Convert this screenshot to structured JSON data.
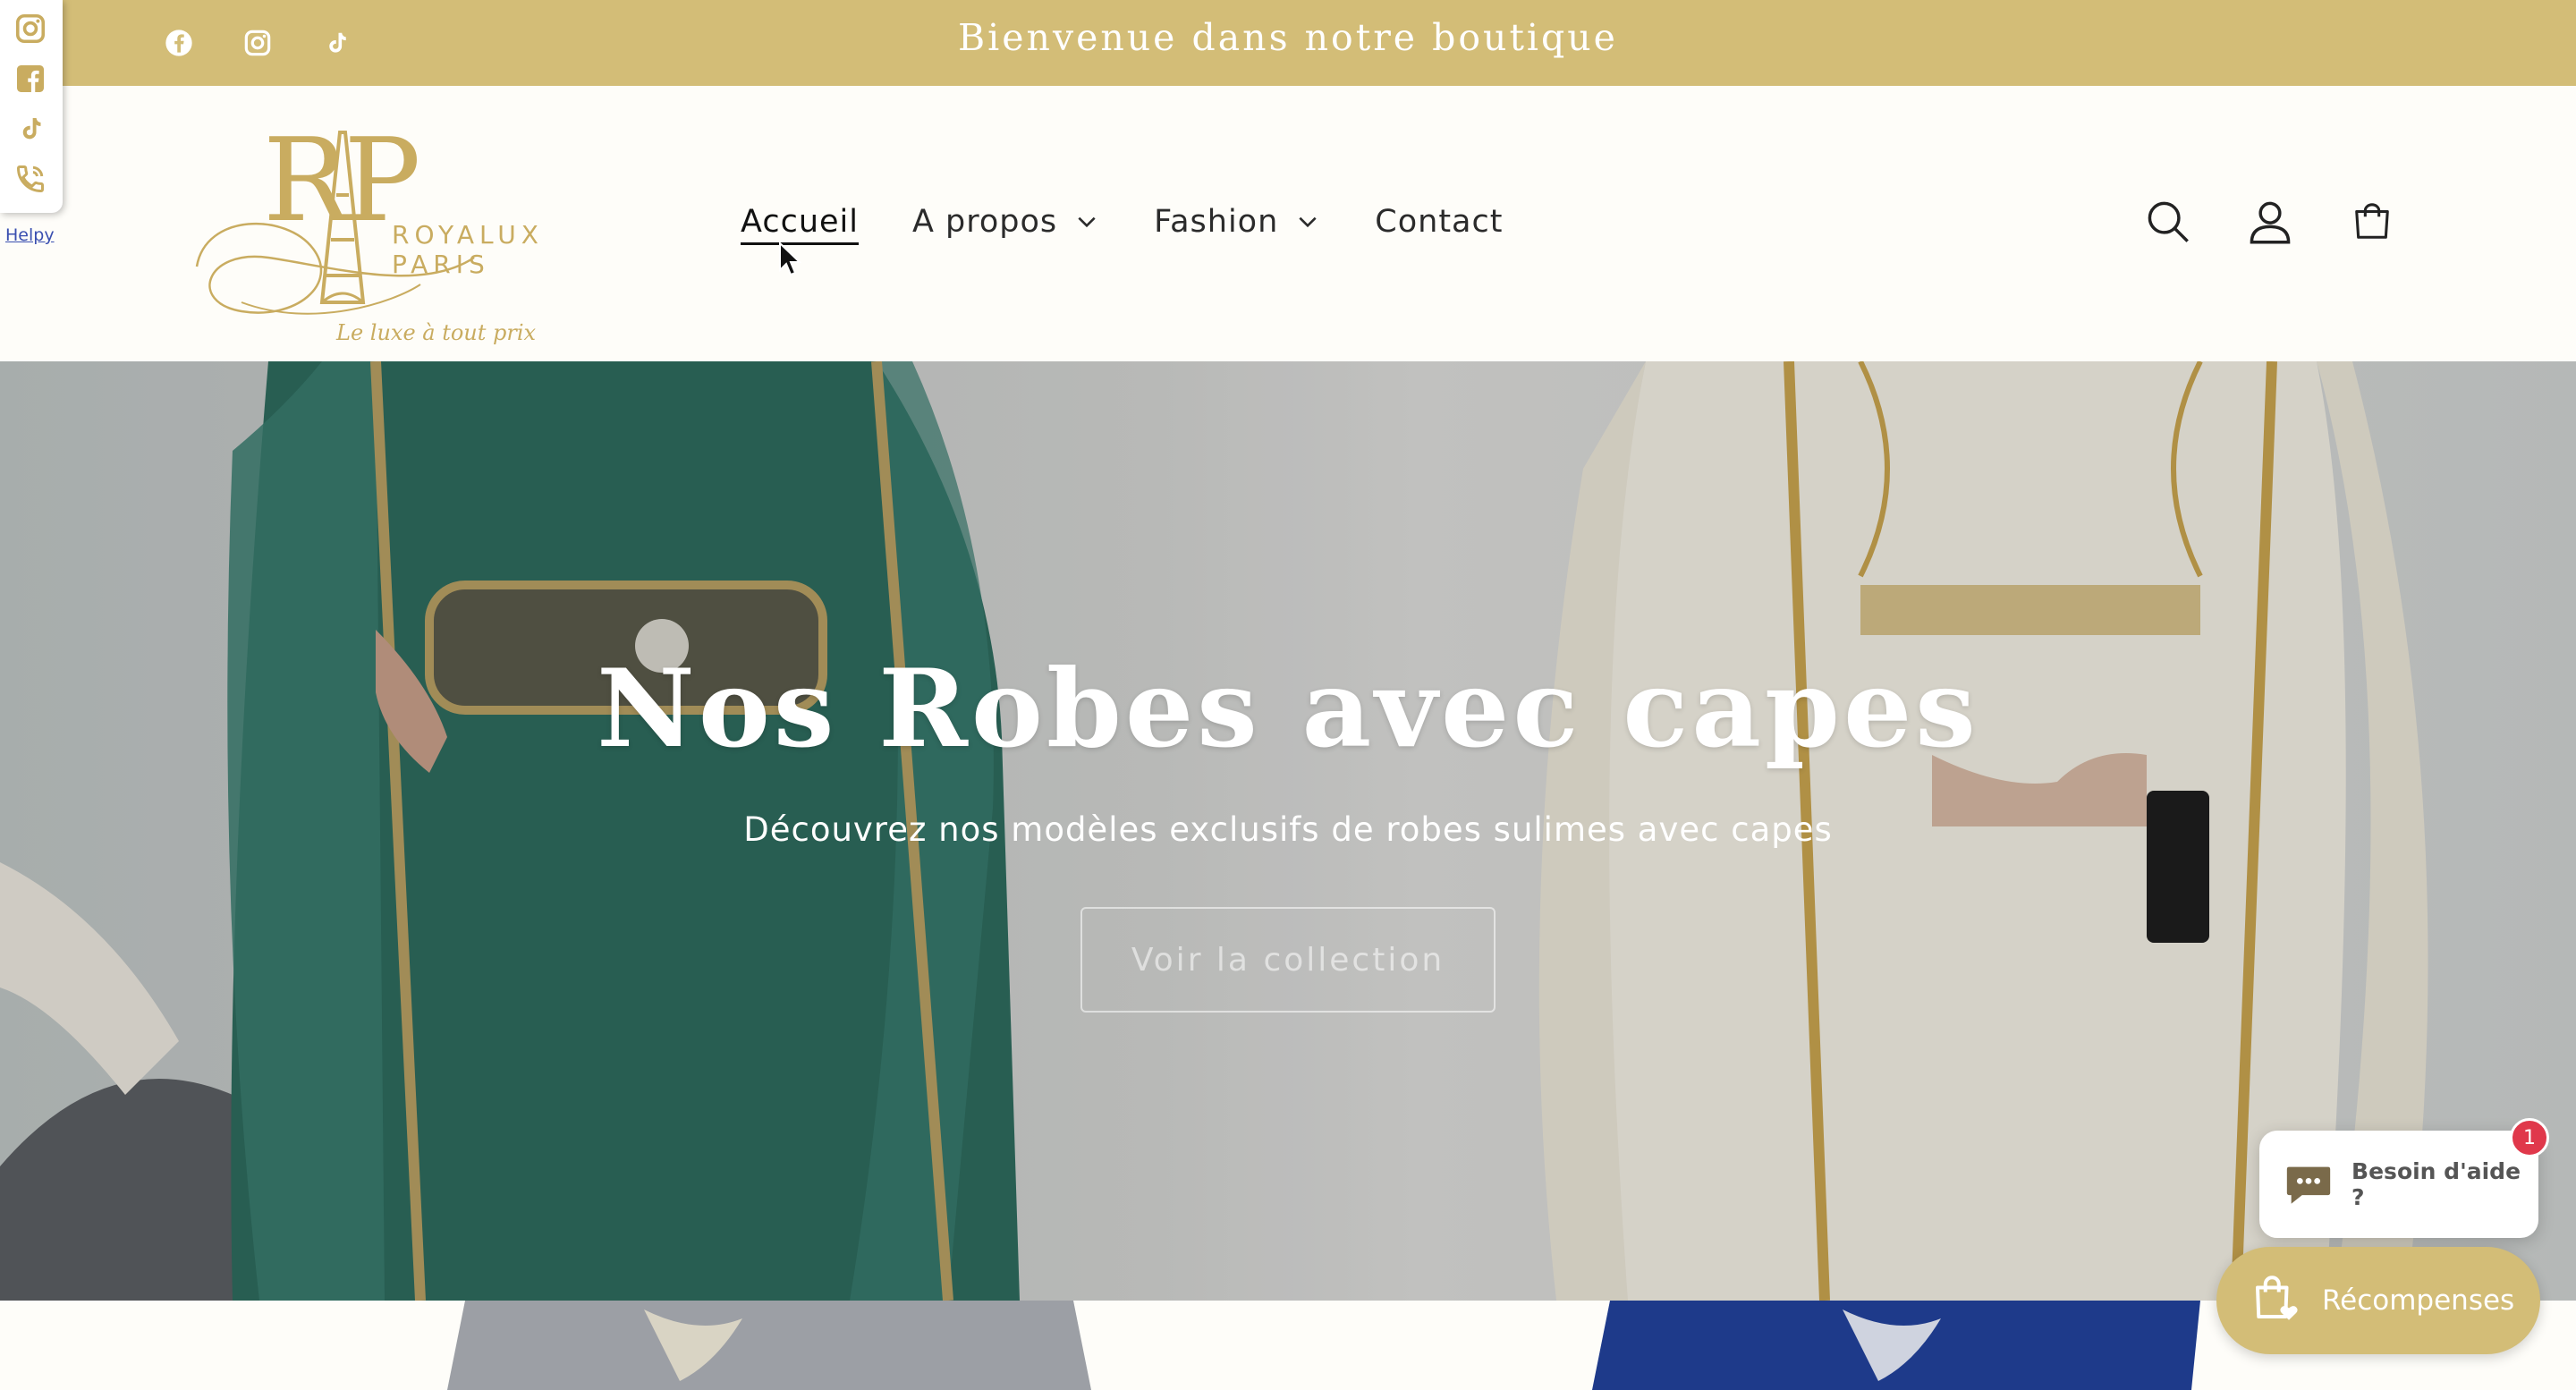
{
  "announcement": {
    "message": "Bienvenue dans notre boutique",
    "socials": [
      "facebook-icon",
      "instagram-icon",
      "tiktok-icon"
    ]
  },
  "helpy": {
    "icons": [
      "instagram-icon",
      "facebook-icon",
      "tiktok-icon",
      "phone-icon"
    ],
    "label": "Helpy"
  },
  "logo": {
    "monogram": "RP",
    "brand": "ROYALUX PARIS",
    "tagline": "Le luxe à tout prix"
  },
  "nav": {
    "items": [
      {
        "label": "Accueil",
        "active": true,
        "dropdown": false
      },
      {
        "label": "A propos",
        "active": false,
        "dropdown": true
      },
      {
        "label": "Fashion",
        "active": false,
        "dropdown": true
      },
      {
        "label": "Contact",
        "active": false,
        "dropdown": false
      }
    ]
  },
  "header_icons": [
    "search-icon",
    "account-icon",
    "cart-icon"
  ],
  "hero": {
    "title": "Nos Robes avec capes",
    "subtitle": "Découvrez nos modèles exclusifs de robes sulimes avec capes",
    "cta": "Voir la collection"
  },
  "chat": {
    "label": "Besoin d'aide ?",
    "badge": "1"
  },
  "rewards": {
    "label": "Récompenses"
  },
  "colors": {
    "gold": "#d3bd77",
    "emerald_dress": "#2e6b5e",
    "ivory_dress": "#f3efe4",
    "badge_red": "#e0384b"
  }
}
